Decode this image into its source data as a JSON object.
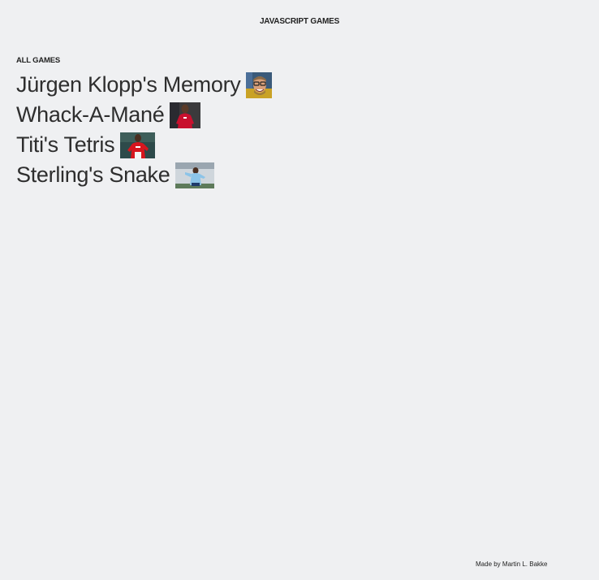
{
  "header": {
    "title": "JAVASCRIPT GAMES"
  },
  "games_section": {
    "heading": "ALL GAMES",
    "items": [
      {
        "label": "Jürgen Klopp's Memory",
        "thumbnail": "klopp-photo"
      },
      {
        "label": "Whack-A-Mané",
        "thumbnail": "mane-photo"
      },
      {
        "label": "Titi's Tetris",
        "thumbnail": "henry-photo"
      },
      {
        "label": "Sterling's Snake",
        "thumbnail": "sterling-photo"
      }
    ]
  },
  "footer": {
    "credit": "Made by Martin L. Bakke"
  }
}
